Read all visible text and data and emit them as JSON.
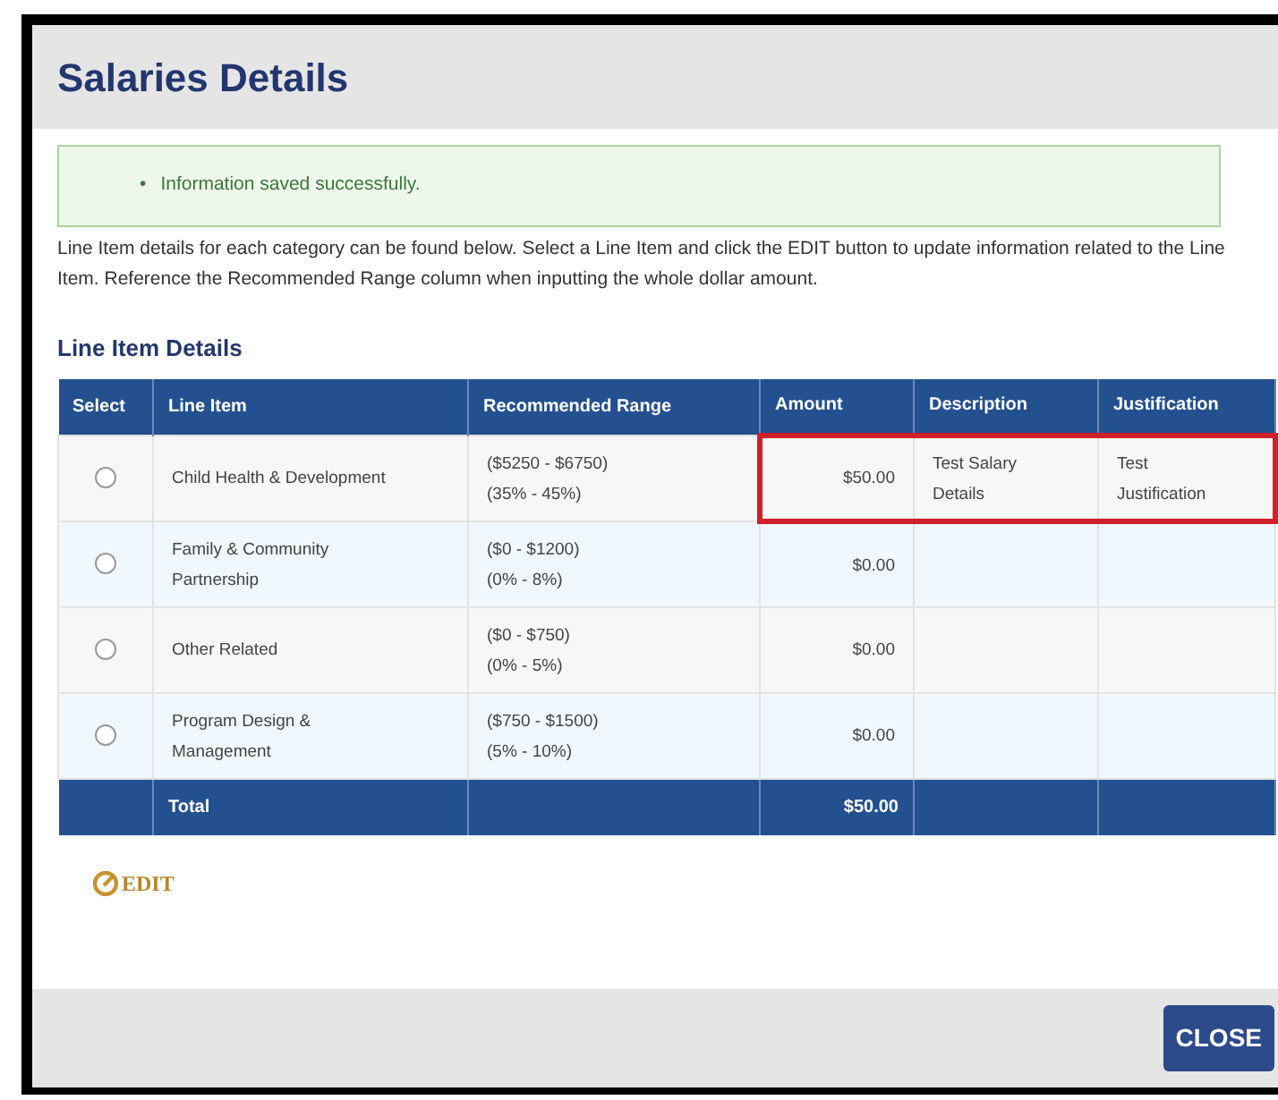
{
  "dialog": {
    "title": "Salaries Details"
  },
  "alert": {
    "messages": [
      {
        "bullet": "•",
        "text": "Information saved successfully."
      }
    ]
  },
  "intro": "Line Item details for each category can be found below. Select a Line Item and click the EDIT button to update information related to the Line Item. Reference the Recommended Range column when inputting the whole dollar amount.",
  "section_title": "Line Item Details",
  "table": {
    "columns": [
      "Select",
      "Line Item",
      "Recommended Range",
      "Amount",
      "Description",
      "Justification"
    ],
    "rows": [
      {
        "selected": false,
        "highlighted": true,
        "line_item": "Child Health & Development",
        "range": [
          "($5250 - $6750)",
          "(35% - 45%)"
        ],
        "amount": "$50.00",
        "description": "Test Salary Details",
        "justification": "Test Justification"
      },
      {
        "selected": false,
        "highlighted": false,
        "line_item": "Family & Community Partnership",
        "range": [
          "($0 - $1200)",
          "(0% - 8%)"
        ],
        "amount": "$0.00"
      },
      {
        "selected": false,
        "highlighted": false,
        "line_item": "Other Related",
        "range": [
          "($0 - $750)",
          "(0% - 5%)"
        ],
        "amount": "$0.00"
      },
      {
        "selected": false,
        "highlighted": false,
        "line_item": "Program Design & Management",
        "range": [
          "($750 - $1500)",
          "(5% - 10%)"
        ],
        "amount": "$0.00"
      }
    ],
    "total": {
      "label": "Total",
      "amount": "$50.00"
    }
  },
  "edit_button": "EDIT",
  "close_button": "CLOSE"
}
